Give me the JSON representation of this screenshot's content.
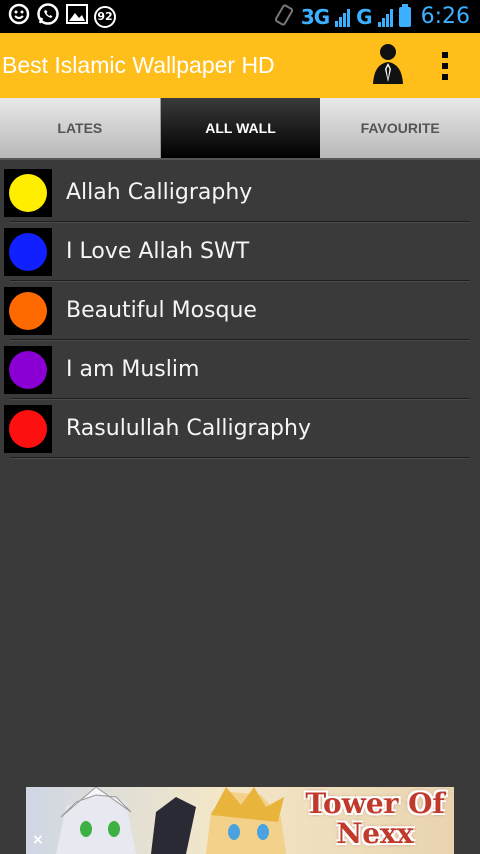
{
  "status_bar": {
    "notification_icons": [
      "smiley-icon",
      "whatsapp-icon",
      "image-icon"
    ],
    "badge_count": "92",
    "network": "3G",
    "network_extra": "G",
    "time": "6:26",
    "accent_color": "#3bb0ff"
  },
  "app_bar": {
    "title": "Best Islamic Wallpaper HD",
    "background_color": "#ffbe1a",
    "actions": [
      "account-icon",
      "overflow-menu-icon"
    ]
  },
  "tabs": [
    {
      "label": "LATES",
      "active": false
    },
    {
      "label": "ALL WALL",
      "active": true
    },
    {
      "label": "FAVOURITE",
      "active": false
    }
  ],
  "list": {
    "items": [
      {
        "label": "Allah Calligraphy",
        "color": "#ffee00"
      },
      {
        "label": "I Love Allah SWT",
        "color": "#1020ff"
      },
      {
        "label": "Beautiful Mosque",
        "color": "#ff6a00"
      },
      {
        "label": "I am Muslim",
        "color": "#8a00d4"
      },
      {
        "label": "Rasulullah Calligraphy",
        "color": "#ff1010"
      }
    ]
  },
  "ad": {
    "title_line1": "Tower Of",
    "title_line2": "Nexx",
    "close_symbol": "×"
  }
}
